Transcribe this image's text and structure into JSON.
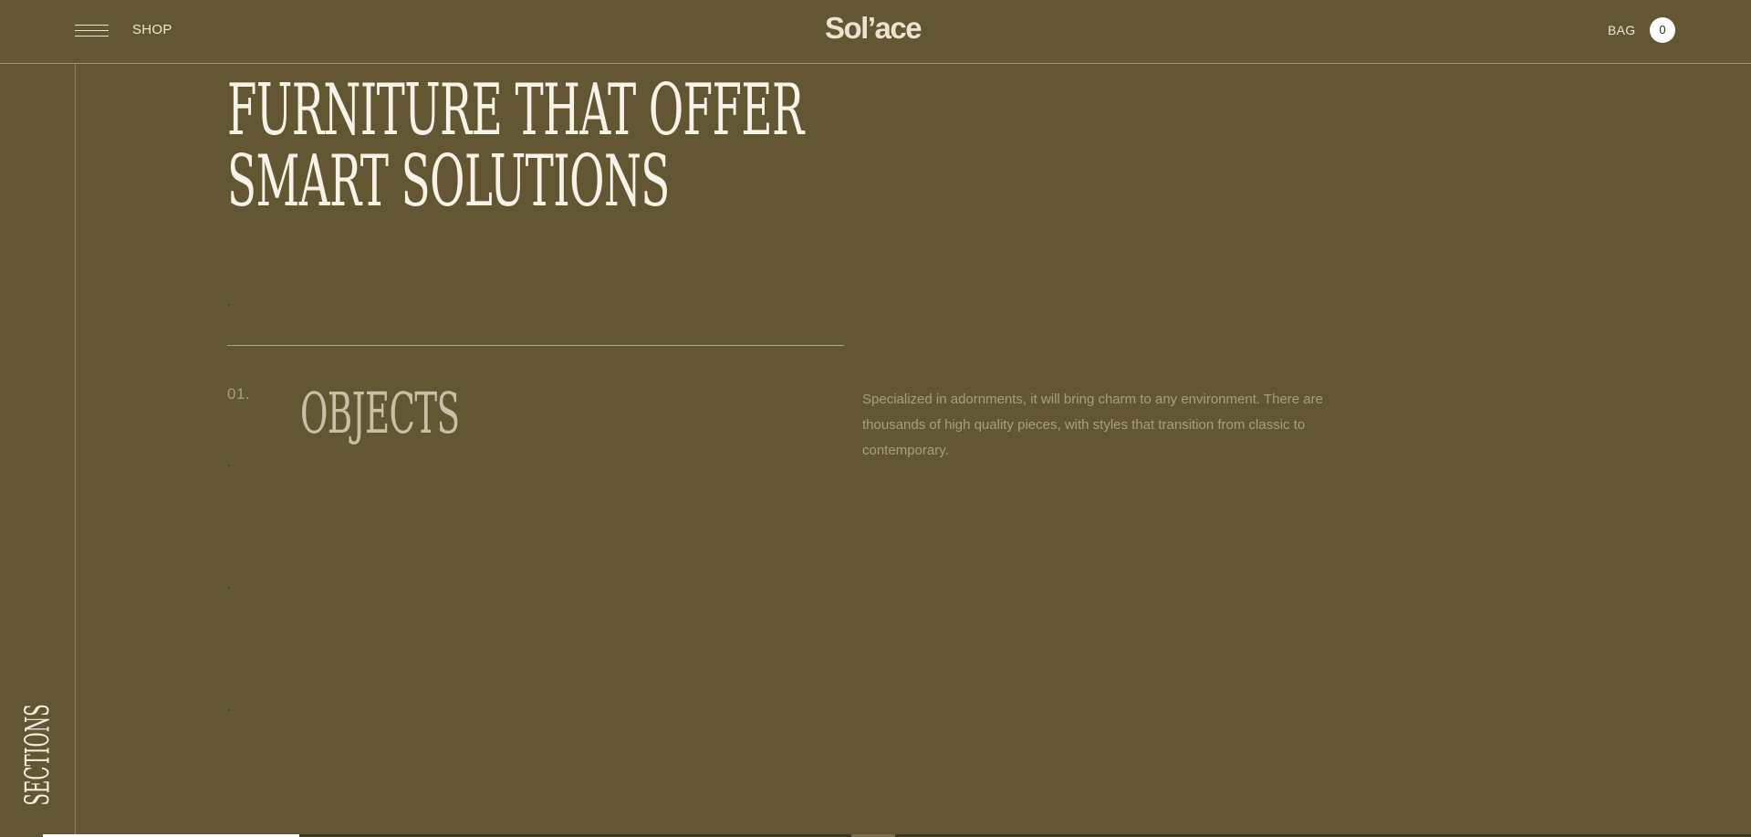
{
  "header": {
    "shop_label": "SHOP",
    "logo": "Sol’ace",
    "bag_label": "BAG",
    "bag_count": "0"
  },
  "sidebar": {
    "sections_label": "SECTIONS"
  },
  "main": {
    "headline_line1": "FURNITURE THAT OFFER",
    "headline_line2": "SMART SOLUTIONS",
    "section": {
      "index": "01.",
      "title": "OBJECTS",
      "description": "Specialized in adornments, it will bring charm to any environment. There are thousands of high quality pieces, with styles that transition from classic to contemporary."
    }
  },
  "scroll_progress": {
    "fraction": 0.15
  },
  "colors": {
    "background": "#635733",
    "text_light": "#f7f3e6",
    "text_muted": "#a99d80"
  },
  "icons": {
    "menu": "hamburger-icon"
  }
}
